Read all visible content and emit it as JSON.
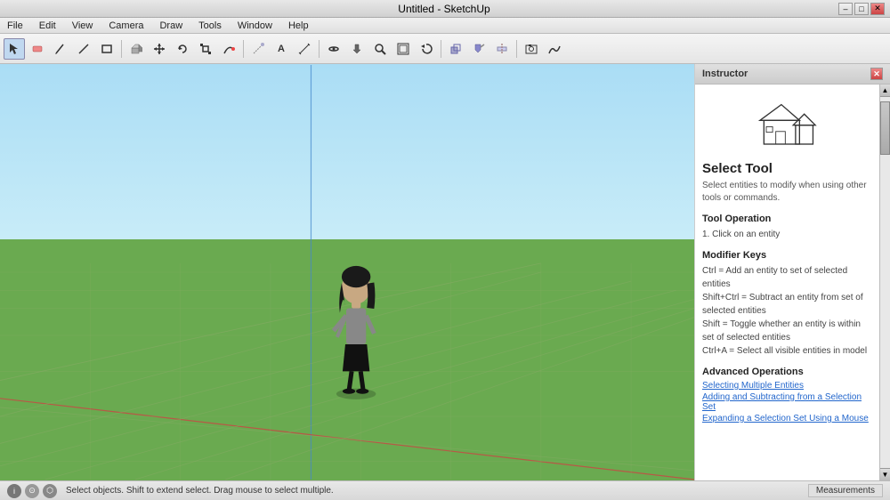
{
  "titlebar": {
    "title": "Untitled - SketchUp",
    "minimize": "–",
    "restore": "□",
    "close": "✕"
  },
  "menubar": {
    "items": [
      "File",
      "Edit",
      "View",
      "Camera",
      "Draw",
      "Tools",
      "Window",
      "Help"
    ]
  },
  "toolbar": {
    "tools": [
      {
        "name": "select",
        "icon": "↖",
        "active": true
      },
      {
        "name": "eraser",
        "icon": "◻"
      },
      {
        "name": "pencil",
        "icon": "✏"
      },
      {
        "name": "line",
        "icon": "╱"
      },
      {
        "name": "shape",
        "icon": "⬜"
      },
      {
        "name": "sep1",
        "sep": true
      },
      {
        "name": "push-pull",
        "icon": "⬛"
      },
      {
        "name": "move",
        "icon": "✥"
      },
      {
        "name": "rotate",
        "icon": "↻"
      },
      {
        "name": "scale",
        "icon": "⤡"
      },
      {
        "name": "follow-me",
        "icon": "⬡"
      },
      {
        "name": "sep2",
        "sep": true
      },
      {
        "name": "tape",
        "icon": "📐"
      },
      {
        "name": "text",
        "icon": "A"
      },
      {
        "name": "3d-text",
        "icon": "𝐀"
      },
      {
        "name": "sep3",
        "sep": true
      },
      {
        "name": "orbit",
        "icon": "⊙"
      },
      {
        "name": "pan",
        "icon": "✋"
      },
      {
        "name": "zoom",
        "icon": "🔍"
      },
      {
        "name": "zoom-ext",
        "icon": "⊞"
      },
      {
        "name": "prev-next",
        "icon": "⤹"
      },
      {
        "name": "sep4",
        "sep": true
      },
      {
        "name": "components",
        "icon": "⬡"
      },
      {
        "name": "paint",
        "icon": "🪣"
      },
      {
        "name": "section",
        "icon": "▤"
      },
      {
        "name": "sep5",
        "sep": true
      },
      {
        "name": "photo1",
        "icon": "📷"
      },
      {
        "name": "photo2",
        "icon": "🎨"
      }
    ]
  },
  "canvas": {
    "background_sky": "#aaddf5",
    "background_ground": "#6aaa50"
  },
  "instructor": {
    "header": "Instructor",
    "tool_title": "Select Tool",
    "tool_subtitle": "Select entities to modify when using other tools or commands.",
    "sections": [
      {
        "title": "Tool Operation",
        "content": "1.   Click on an entity"
      },
      {
        "title": "Modifier Keys",
        "content": "Ctrl = Add an entity to set of selected entities\nShift+Ctrl = Subtract an entity from set of selected entities\nShift = Toggle whether an entity is within set of selected entities\nCtrl+A = Select all visible entities in model"
      },
      {
        "title": "Advanced Operations",
        "links": [
          "Selecting Multiple Entities",
          "Adding and Subtracting from a Selection Set",
          "Expanding a Selection Set Using a Mouse"
        ]
      }
    ]
  },
  "statusbar": {
    "text": "Select objects. Shift to extend select. Drag mouse to select multiple.",
    "measurements_label": "Measurements"
  }
}
